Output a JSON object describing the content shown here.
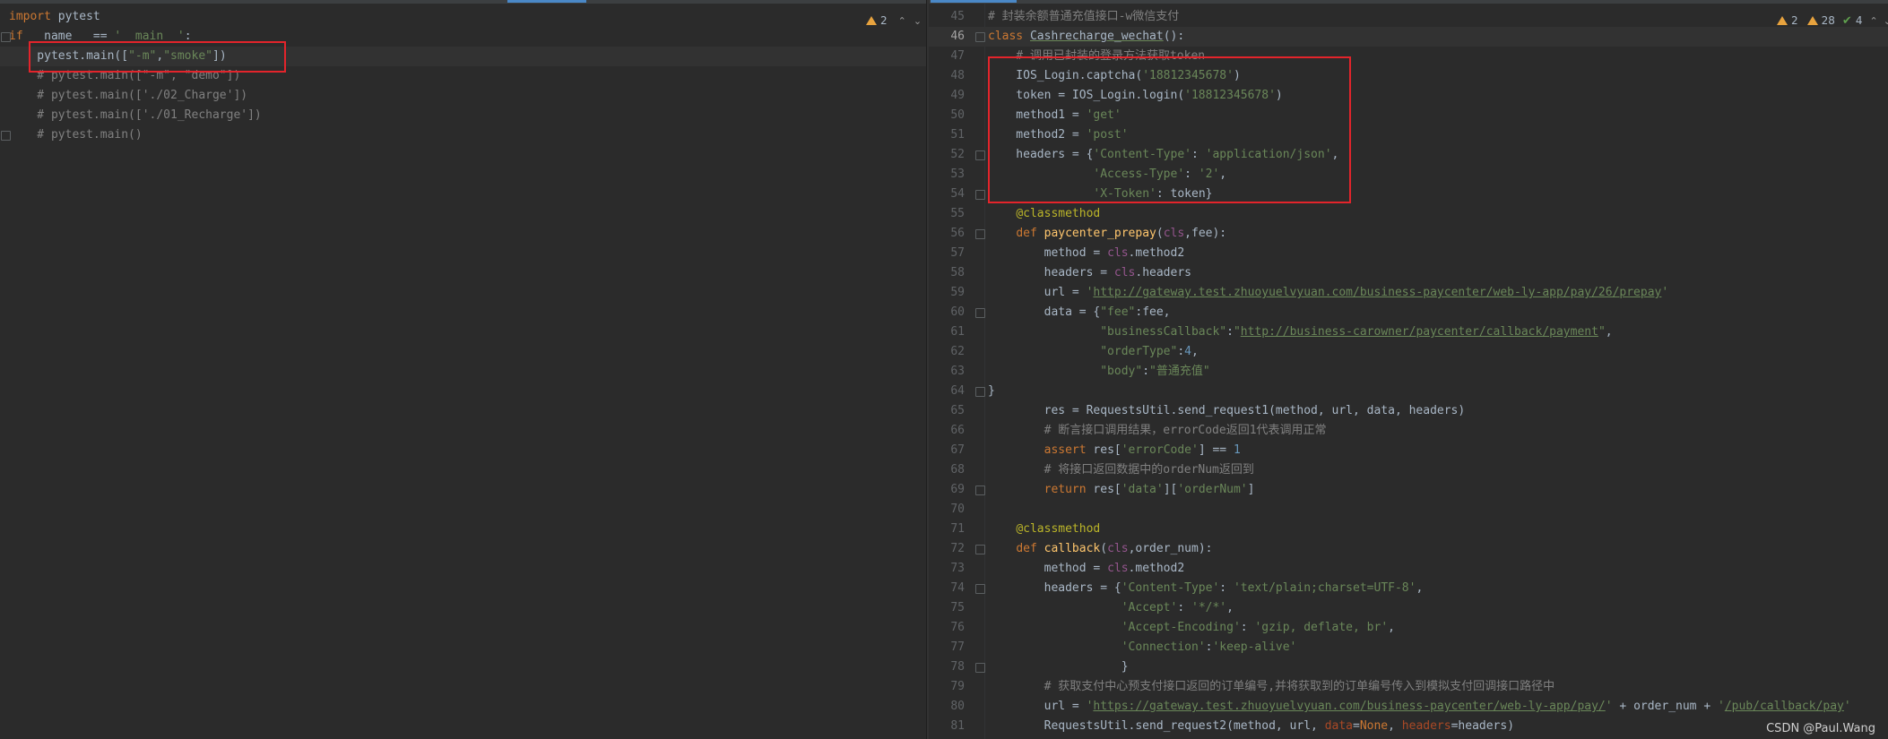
{
  "left_editor": {
    "inspection": {
      "warnings": "2"
    },
    "lines": [
      {
        "tokens": [
          {
            "t": "import",
            "c": "kw"
          },
          {
            "t": " pytest"
          }
        ]
      },
      {
        "tokens": [
          {
            "t": "if",
            "c": "kw"
          },
          {
            "t": " __name__ == "
          },
          {
            "t": "'__main__'",
            "c": "str"
          },
          {
            "t": ":"
          }
        ]
      },
      {
        "tokens": [
          {
            "t": "    pytest.main(["
          },
          {
            "t": "\"-m\"",
            "c": "str"
          },
          {
            "t": ","
          },
          {
            "t": "\"smoke\"",
            "c": "str"
          },
          {
            "t": "])"
          }
        ]
      },
      {
        "tokens": [
          {
            "t": "    # pytest.main([\"-m\", \"demo\"])",
            "c": "cmt"
          }
        ]
      },
      {
        "tokens": [
          {
            "t": "    # pytest.main(['./02_Charge'])",
            "c": "cmt"
          }
        ]
      },
      {
        "tokens": [
          {
            "t": "    # pytest.main(['./01_Recharge'])",
            "c": "cmt"
          }
        ]
      },
      {
        "tokens": [
          {
            "t": "    # pytest.main()",
            "c": "cmt"
          }
        ]
      }
    ]
  },
  "right_editor": {
    "inspection": {
      "warnings": "2",
      "weak_warnings": "28",
      "typos": "4"
    },
    "lines": [
      {
        "n": "45",
        "tokens": [
          {
            "t": "# 封装余额普通充值接口-w微信支付",
            "c": "cmt"
          }
        ]
      },
      {
        "n": "46",
        "tokens": [
          {
            "t": "class",
            "c": "kw"
          },
          {
            "t": " "
          },
          {
            "t": "Cashrecharge_wechat",
            "c": "cls"
          },
          {
            "t": "():"
          }
        ]
      },
      {
        "n": "47",
        "tokens": [
          {
            "t": "    # 调用已封装的登录方法获取token",
            "c": "cmt"
          }
        ]
      },
      {
        "n": "48",
        "tokens": [
          {
            "t": "    IOS_Login.captcha("
          },
          {
            "t": "'18812345678'",
            "c": "str"
          },
          {
            "t": ")"
          }
        ]
      },
      {
        "n": "49",
        "tokens": [
          {
            "t": "    token = IOS_Login.login("
          },
          {
            "t": "'18812345678'",
            "c": "str"
          },
          {
            "t": ")"
          }
        ]
      },
      {
        "n": "50",
        "tokens": [
          {
            "t": "    method1 = "
          },
          {
            "t": "'get'",
            "c": "str"
          }
        ]
      },
      {
        "n": "51",
        "tokens": [
          {
            "t": "    method2 = "
          },
          {
            "t": "'post'",
            "c": "str"
          }
        ]
      },
      {
        "n": "52",
        "tokens": [
          {
            "t": "    headers = {"
          },
          {
            "t": "'Content-Type'",
            "c": "str"
          },
          {
            "t": ": "
          },
          {
            "t": "'application/json'",
            "c": "str"
          },
          {
            "t": ","
          }
        ]
      },
      {
        "n": "53",
        "tokens": [
          {
            "t": "               "
          },
          {
            "t": "'Access-Type'",
            "c": "str"
          },
          {
            "t": ": "
          },
          {
            "t": "'2'",
            "c": "str"
          },
          {
            "t": ","
          }
        ]
      },
      {
        "n": "54",
        "tokens": [
          {
            "t": "               "
          },
          {
            "t": "'X-Token'",
            "c": "str"
          },
          {
            "t": ": token}"
          }
        ]
      },
      {
        "n": "55",
        "tokens": [
          {
            "t": "    "
          },
          {
            "t": "@classmethod",
            "c": "dec"
          }
        ]
      },
      {
        "n": "56",
        "tokens": [
          {
            "t": "    "
          },
          {
            "t": "def ",
            "c": "kw"
          },
          {
            "t": "paycenter_prepay",
            "c": "fn"
          },
          {
            "t": "("
          },
          {
            "t": "cls",
            "c": "self"
          },
          {
            "t": ","
          },
          {
            "t": "fee"
          },
          {
            "t": "):"
          }
        ]
      },
      {
        "n": "57",
        "tokens": [
          {
            "t": "        method = "
          },
          {
            "t": "cls",
            "c": "self"
          },
          {
            "t": ".method2"
          }
        ]
      },
      {
        "n": "58",
        "tokens": [
          {
            "t": "        headers = "
          },
          {
            "t": "cls",
            "c": "self"
          },
          {
            "t": ".headers"
          }
        ]
      },
      {
        "n": "59",
        "tokens": [
          {
            "t": "        url = "
          },
          {
            "t": "'",
            "c": "str"
          },
          {
            "t": "http://gateway.test.zhuoyuelvyuan.com/business-paycenter/web-ly-app/pay/26/prepay",
            "c": "url green"
          },
          {
            "t": "'",
            "c": "str"
          }
        ]
      },
      {
        "n": "60",
        "tokens": [
          {
            "t": "        data = {"
          },
          {
            "t": "\"fee\"",
            "c": "str"
          },
          {
            "t": ":fee,"
          }
        ]
      },
      {
        "n": "61",
        "tokens": [
          {
            "t": "                "
          },
          {
            "t": "\"businessCallback\"",
            "c": "str"
          },
          {
            "t": ":"
          },
          {
            "t": "\"",
            "c": "str"
          },
          {
            "t": "http://business-carowner/paycenter/callback/payment",
            "c": "url green"
          },
          {
            "t": "\"",
            "c": "str"
          },
          {
            "t": ","
          }
        ]
      },
      {
        "n": "62",
        "tokens": [
          {
            "t": "                "
          },
          {
            "t": "\"orderType\"",
            "c": "str"
          },
          {
            "t": ":"
          },
          {
            "t": "4",
            "c": "num"
          },
          {
            "t": ","
          }
        ]
      },
      {
        "n": "63",
        "tokens": [
          {
            "t": "                "
          },
          {
            "t": "\"body\"",
            "c": "str"
          },
          {
            "t": ":"
          },
          {
            "t": "\"普通充值\"",
            "c": "str"
          }
        ]
      },
      {
        "n": "64",
        "tokens": [
          {
            "t": "}"
          }
        ]
      },
      {
        "n": "65",
        "tokens": [
          {
            "t": "        res = RequestsUtil.send_request1(method, url, data, headers)"
          }
        ]
      },
      {
        "n": "66",
        "tokens": [
          {
            "t": "        # 断言接口调用结果，errorCode返回1代表调用正常",
            "c": "cmt"
          }
        ]
      },
      {
        "n": "67",
        "tokens": [
          {
            "t": "        "
          },
          {
            "t": "assert",
            "c": "kw"
          },
          {
            "t": " res["
          },
          {
            "t": "'errorCode'",
            "c": "str"
          },
          {
            "t": "] == "
          },
          {
            "t": "1",
            "c": "num"
          }
        ]
      },
      {
        "n": "68",
        "tokens": [
          {
            "t": "        # 将接口返回数据中的orderNum返回到",
            "c": "cmt"
          }
        ]
      },
      {
        "n": "69",
        "tokens": [
          {
            "t": "        "
          },
          {
            "t": "return",
            "c": "kw"
          },
          {
            "t": " res["
          },
          {
            "t": "'data'",
            "c": "str"
          },
          {
            "t": "]["
          },
          {
            "t": "'orderNum'",
            "c": "str"
          },
          {
            "t": "]"
          }
        ]
      },
      {
        "n": "70",
        "tokens": [
          {
            "t": ""
          }
        ]
      },
      {
        "n": "71",
        "tokens": [
          {
            "t": "    "
          },
          {
            "t": "@classmethod",
            "c": "dec"
          }
        ]
      },
      {
        "n": "72",
        "tokens": [
          {
            "t": "    "
          },
          {
            "t": "def ",
            "c": "kw"
          },
          {
            "t": "callback",
            "c": "fn"
          },
          {
            "t": "("
          },
          {
            "t": "cls",
            "c": "self"
          },
          {
            "t": ","
          },
          {
            "t": "order_num"
          },
          {
            "t": "):"
          }
        ]
      },
      {
        "n": "73",
        "tokens": [
          {
            "t": "        method = "
          },
          {
            "t": "cls",
            "c": "self"
          },
          {
            "t": ".method2"
          }
        ]
      },
      {
        "n": "74",
        "tokens": [
          {
            "t": "        headers = {"
          },
          {
            "t": "'Content-Type'",
            "c": "str"
          },
          {
            "t": ": "
          },
          {
            "t": "'text/plain;charset=UTF-8'",
            "c": "str"
          },
          {
            "t": ","
          }
        ]
      },
      {
        "n": "75",
        "tokens": [
          {
            "t": "                   "
          },
          {
            "t": "'Accept'",
            "c": "str"
          },
          {
            "t": ": "
          },
          {
            "t": "'*/*'",
            "c": "str"
          },
          {
            "t": ","
          }
        ]
      },
      {
        "n": "76",
        "tokens": [
          {
            "t": "                   "
          },
          {
            "t": "'Accept-Encoding'",
            "c": "str"
          },
          {
            "t": ": "
          },
          {
            "t": "'gzip, deflate, br'",
            "c": "str"
          },
          {
            "t": ","
          }
        ]
      },
      {
        "n": "77",
        "tokens": [
          {
            "t": "                   "
          },
          {
            "t": "'Connection'",
            "c": "str"
          },
          {
            "t": ":"
          },
          {
            "t": "'keep-alive'",
            "c": "str"
          }
        ]
      },
      {
        "n": "78",
        "tokens": [
          {
            "t": "                   }"
          }
        ]
      },
      {
        "n": "79",
        "tokens": [
          {
            "t": "        # 获取支付中心预支付接口返回的订单编号,并将获取到的订单编号传入到模拟支付回调接口路径中",
            "c": "cmt"
          }
        ]
      },
      {
        "n": "80",
        "tokens": [
          {
            "t": "        url = "
          },
          {
            "t": "'",
            "c": "str"
          },
          {
            "t": "https://gateway.test.zhuoyuelvyuan.com/business-paycenter/web-ly-app/pay/",
            "c": "url green"
          },
          {
            "t": "'",
            "c": "str"
          },
          {
            "t": " + order_num + "
          },
          {
            "t": "'",
            "c": "str"
          },
          {
            "t": "/pub/callback/pay",
            "c": "url green"
          },
          {
            "t": "'",
            "c": "str"
          }
        ]
      },
      {
        "n": "81",
        "tokens": [
          {
            "t": "        RequestsUtil.send_request2(method, url, "
          },
          {
            "t": "data",
            "c": "pname"
          },
          {
            "t": "="
          },
          {
            "t": "None",
            "c": "kw"
          },
          {
            "t": ", "
          },
          {
            "t": "headers",
            "c": "pname"
          },
          {
            "t": "=headers)"
          }
        ]
      }
    ]
  },
  "watermark": "CSDN @Paul.Wang"
}
